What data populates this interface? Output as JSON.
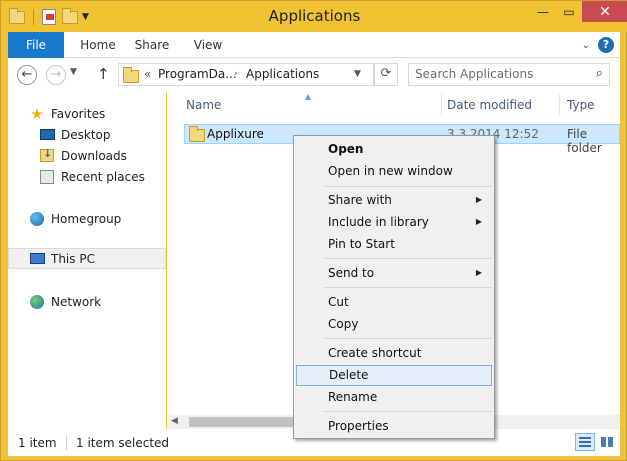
{
  "window": {
    "title": "Applications"
  },
  "ribbon": {
    "tabs": [
      "File",
      "Home",
      "Share",
      "View"
    ]
  },
  "address": {
    "crumbs": [
      "«",
      "ProgramDa...",
      "›",
      "Applications"
    ]
  },
  "search": {
    "placeholder": "Search Applications"
  },
  "nav_pane": {
    "favorites": "Favorites",
    "desktop": "Desktop",
    "downloads": "Downloads",
    "recent": "Recent places",
    "homegroup": "Homegroup",
    "thispc": "This PC",
    "network": "Network"
  },
  "columns": {
    "name": "Name",
    "date": "Date modified",
    "type": "Type"
  },
  "rows": [
    {
      "name": "Applixure",
      "date": "3.3.2014 12:52",
      "type": "File folder"
    }
  ],
  "status": {
    "count": "1 item",
    "selected": "1 item selected"
  },
  "context_menu": {
    "open": "Open",
    "open_new": "Open in new window",
    "share_with": "Share with",
    "include_library": "Include in library",
    "pin_start": "Pin to Start",
    "send_to": "Send to",
    "cut": "Cut",
    "copy": "Copy",
    "create_shortcut": "Create shortcut",
    "delete": "Delete",
    "rename": "Rename",
    "properties": "Properties",
    "highlighted": "Delete"
  },
  "colors": {
    "file_tab": "#1979ca",
    "titlebar": "#f1c232",
    "close": "#c74b50",
    "selection": "#cce8ff"
  }
}
